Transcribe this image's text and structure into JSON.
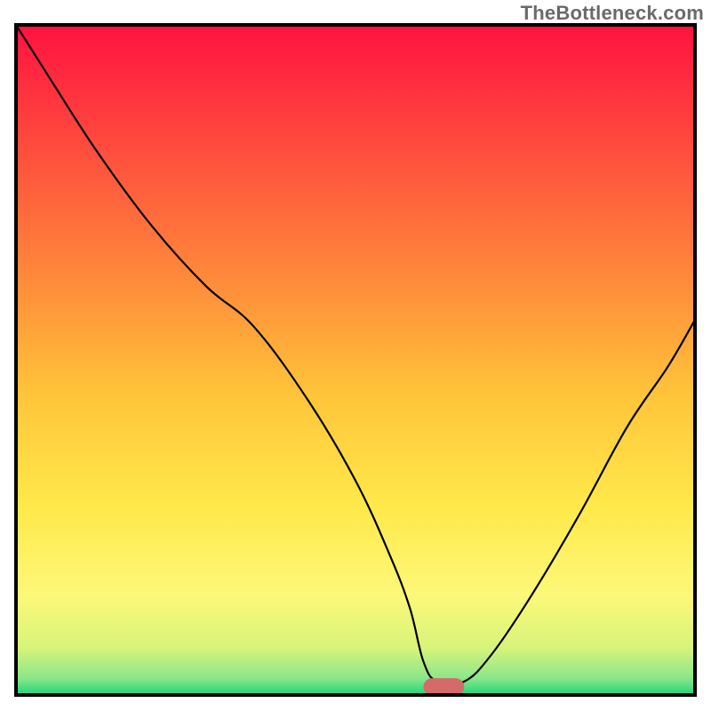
{
  "watermark": "TheBottleneck.com",
  "chart_data": {
    "type": "line",
    "title": "",
    "xlabel": "",
    "ylabel": "",
    "axes_visible": false,
    "grid": false,
    "xlim": [
      0,
      100
    ],
    "ylim": [
      0,
      100
    ],
    "background_gradient": {
      "direction": "vertical",
      "stops": [
        {
          "offset": 0.0,
          "color": "#ff1240"
        },
        {
          "offset": 0.18,
          "color": "#ff4b3e"
        },
        {
          "offset": 0.38,
          "color": "#ff8a3a"
        },
        {
          "offset": 0.55,
          "color": "#ffc43a"
        },
        {
          "offset": 0.72,
          "color": "#ffe94a"
        },
        {
          "offset": 0.85,
          "color": "#fdf879"
        },
        {
          "offset": 0.93,
          "color": "#d7f47a"
        },
        {
          "offset": 0.975,
          "color": "#8be68a"
        },
        {
          "offset": 1.0,
          "color": "#1fd57a"
        }
      ]
    },
    "series": [
      {
        "name": "bottleneck-curve",
        "color": "#000000",
        "stroke_width": 2.2,
        "x": [
          0,
          5,
          12,
          20,
          28,
          35,
          43,
          50,
          55,
          58,
          60,
          62,
          66,
          70,
          76,
          83,
          90,
          96,
          100
        ],
        "values": [
          100,
          92,
          81,
          70,
          61,
          55,
          44,
          32,
          21,
          13,
          5,
          2,
          2,
          6,
          15,
          27,
          40,
          49,
          56
        ]
      }
    ],
    "marker": {
      "name": "optimal-point",
      "shape": "rounded-rect",
      "color": "#d46a6a",
      "x": 63,
      "y": 1.2,
      "width": 6,
      "height": 2.6
    },
    "frame": {
      "color": "#000000",
      "stroke_width": 4
    }
  }
}
